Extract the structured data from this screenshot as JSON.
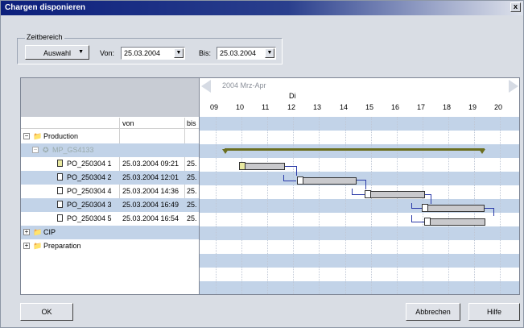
{
  "window": {
    "title": "Chargen disponieren",
    "close": "x"
  },
  "zeitbereich": {
    "label": "Zeitbereich",
    "auswahl": "Auswahl",
    "von_label": "Von:",
    "von_value": "25.03.2004",
    "bis_label": "Bis:",
    "bis_value": "25.03.2004"
  },
  "timeline": {
    "period": "2004 Mrz-Apr",
    "day": "Di",
    "hours": [
      "09",
      "10",
      "11",
      "12",
      "13",
      "14",
      "15",
      "16",
      "17",
      "18",
      "19",
      "20"
    ]
  },
  "grid": {
    "columns": [
      "von",
      "bis"
    ]
  },
  "tree": [
    {
      "label": "Production",
      "von": "",
      "bis": ""
    },
    {
      "label": "MP_GS4133",
      "von": "",
      "bis": ""
    },
    {
      "label": "PO_250304 1",
      "von": "25.03.2004 09:21",
      "bis": "25."
    },
    {
      "label": "PO_250304 2",
      "von": "25.03.2004 12:01",
      "bis": "25."
    },
    {
      "label": "PO_250304 4",
      "von": "25.03.2004 14:36",
      "bis": "25."
    },
    {
      "label": "PO_250304 3",
      "von": "25.03.2004 16:49",
      "bis": "25."
    },
    {
      "label": "PO_250304 5",
      "von": "25.03.2004 16:54",
      "bis": "25."
    },
    {
      "label": "CIP",
      "von": "",
      "bis": ""
    },
    {
      "label": "Preparation",
      "von": "",
      "bis": ""
    }
  ],
  "buttons": {
    "ok": "OK",
    "cancel": "Abbrechen",
    "help": "Hilfe"
  },
  "colors": {
    "stripe": "#c2d3e8",
    "summary": "#6b6e1f",
    "link": "#2a3aa8"
  }
}
